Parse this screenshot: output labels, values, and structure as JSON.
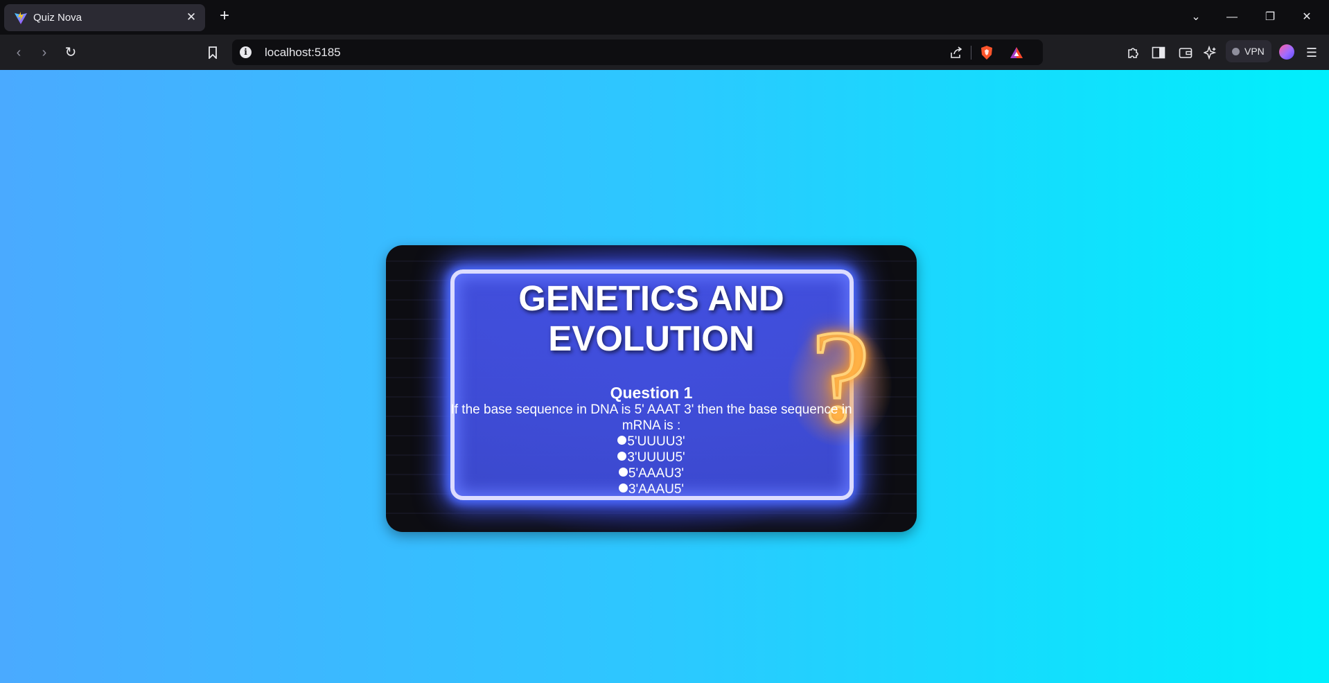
{
  "browser": {
    "tab_title": "Quiz Nova",
    "url": "localhost:5185",
    "vpn_label": "VPN"
  },
  "quiz": {
    "title": "GENETICS AND EVOLUTION",
    "question_label": "Question 1",
    "question_text": "If the base sequence in DNA is 5' AAAT 3' then the base sequence in mRNA is :",
    "options": [
      "5'UUUU3'",
      "3'UUUU5'",
      "5'AAAU3'",
      "3'AAAU5'"
    ]
  },
  "colors": {
    "background_gradient": [
      "#4aaaff",
      "#00effc"
    ],
    "neon_frame": "#4c6bff",
    "question_mark": "#ffb347"
  }
}
